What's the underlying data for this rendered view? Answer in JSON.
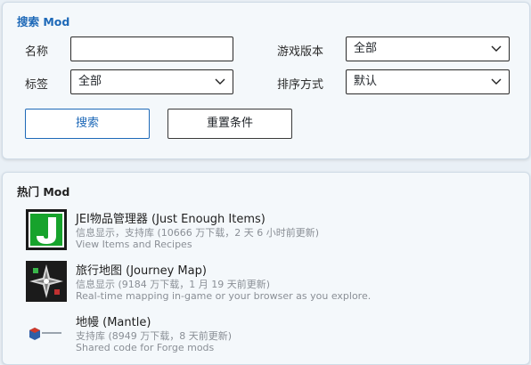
{
  "search": {
    "title": "搜索 Mod",
    "name_label": "名称",
    "name_value": "",
    "tag_label": "标签",
    "tag_value": "全部",
    "version_label": "游戏版本",
    "version_value": "全部",
    "sort_label": "排序方式",
    "sort_value": "默认",
    "search_button": "搜索",
    "reset_button": "重置条件"
  },
  "hot": {
    "title": "热门 Mod",
    "items": [
      {
        "title": "JEI物品管理器 (Just Enough Items)",
        "meta": "信息显示，支持库 (10666 万下载，2 天 6 小时前更新)",
        "desc": "View Items and Recipes",
        "icon": "jei-icon"
      },
      {
        "title": "旅行地图 (Journey Map)",
        "meta": "信息显示 (9184 万下载，1 月 19 天前更新)",
        "desc": "Real-time mapping in-game or your browser as you explore.",
        "icon": "journeymap-icon"
      },
      {
        "title": "地幔 (Mantle)",
        "meta": "支持库 (8949 万下载，8 天前更新)",
        "desc": "Shared code for Forge mods",
        "icon": "mantle-icon"
      }
    ]
  },
  "colors": {
    "accent": "#1e69b8",
    "background": "#e9f0f6",
    "card": "#f4f8fb",
    "muted_text": "#8a8f96"
  }
}
